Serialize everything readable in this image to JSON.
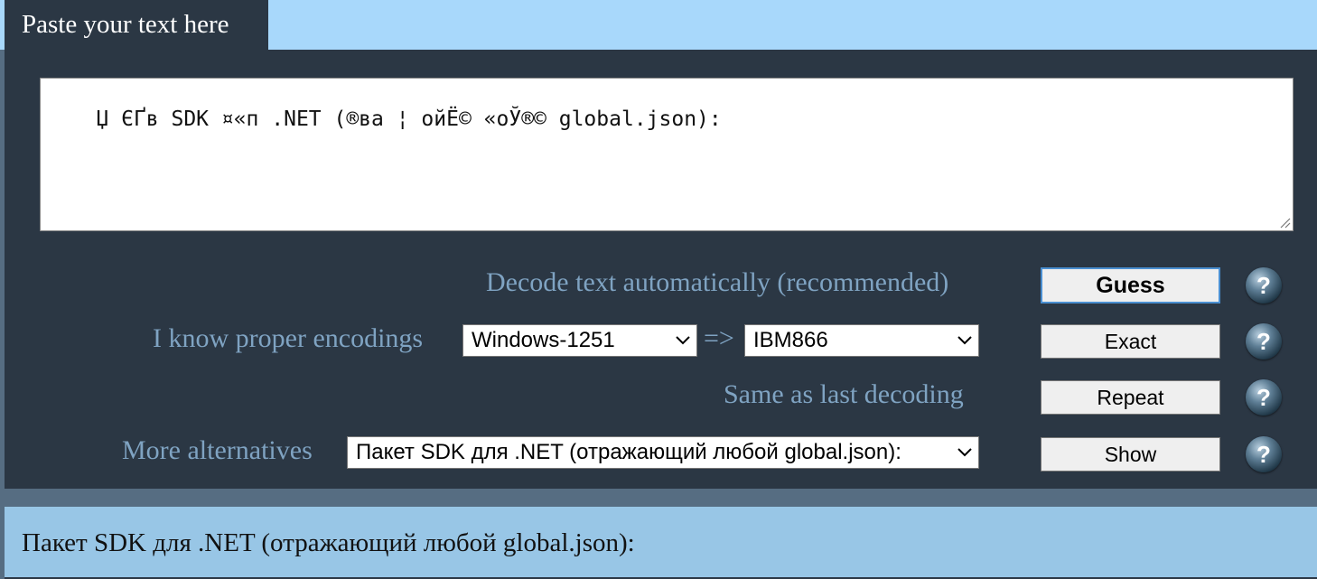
{
  "tab": {
    "title": "Paste your text here"
  },
  "input": {
    "text": "Џ ЄҐв SDK ¤«п .NET (®ва ¦ ойЁ© «оЎ®© global.json):"
  },
  "rows": {
    "guess": {
      "label": "Decode text automatically (recommended)",
      "button": "Guess"
    },
    "exact": {
      "label": "I know proper encodings",
      "from_encoding": "Windows-1251",
      "arrow": "=>",
      "to_encoding": "IBM866",
      "button": "Exact"
    },
    "repeat": {
      "label": "Same as last decoding",
      "button": "Repeat"
    },
    "alternatives": {
      "label": "More alternatives",
      "selected": "Пакет SDK для .NET (отражающий любой global.json):",
      "button": "Show"
    }
  },
  "help_glyph": "?",
  "result": {
    "text": "Пакет SDK для .NET (отражающий любой global.json):"
  },
  "colors": {
    "panel": "#2b3744",
    "top_strip": "#a8d8fb",
    "label": "#7fa3c2",
    "result_bg": "#98c6e6"
  }
}
